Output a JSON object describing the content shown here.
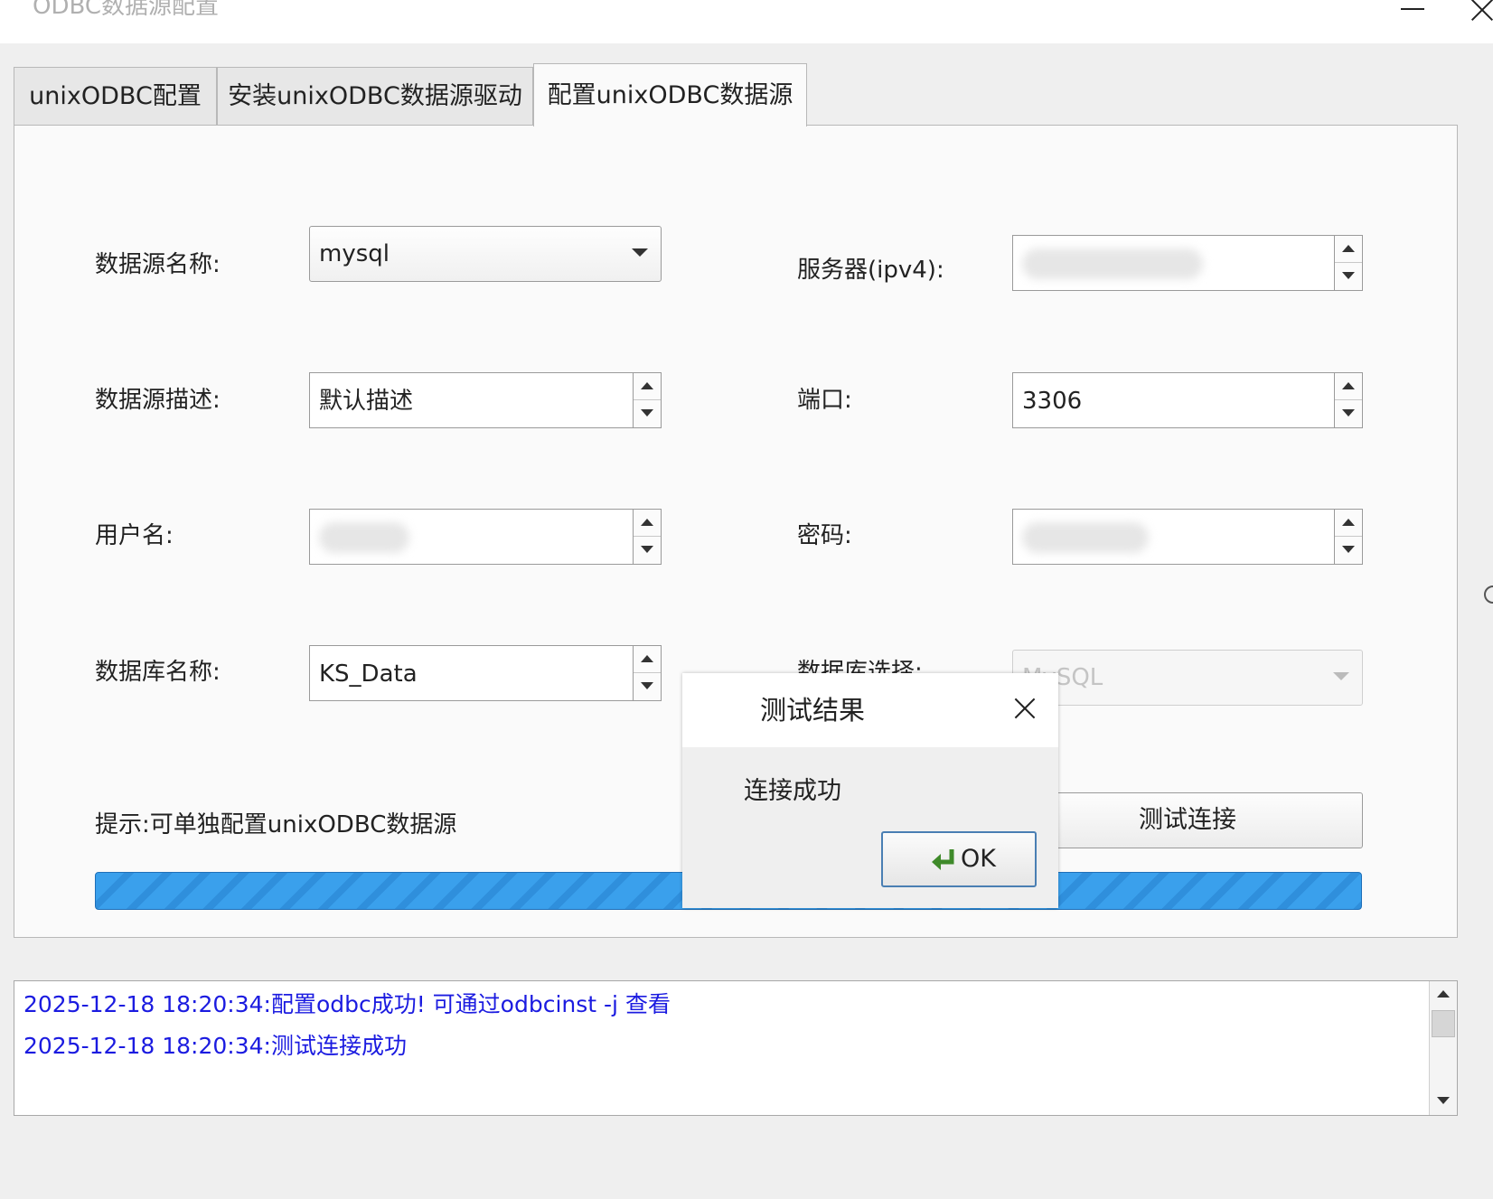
{
  "window": {
    "title": "ODBC数据源配置"
  },
  "tabs": [
    {
      "label": "unixODBC配置",
      "active": false
    },
    {
      "label": "安装unixODBC数据源驱动",
      "active": false
    },
    {
      "label": "配置unixODBC数据源",
      "active": true
    }
  ],
  "form": {
    "datasource_name": {
      "label": "数据源名称:",
      "value": "mysql"
    },
    "datasource_desc": {
      "label": "数据源描述:",
      "value": "默认描述"
    },
    "username": {
      "label": "用户名:",
      "value": ""
    },
    "database_name": {
      "label": "数据库名称:",
      "value": "KS_Data"
    },
    "server": {
      "label": "服务器(ipv4):",
      "value": ""
    },
    "port": {
      "label": "端口:",
      "value": "3306"
    },
    "password": {
      "label": "密码:",
      "value": ""
    },
    "db_select": {
      "label": "数据库选择:",
      "value": "MySQL",
      "disabled": true
    }
  },
  "hint": "提示:可单独配置unixODBC数据源",
  "test_button": "测试连接",
  "progress": {
    "percent": 100
  },
  "dialog": {
    "title": "测试结果",
    "message": "连接成功",
    "ok_label": "OK"
  },
  "log": {
    "lines": [
      "2025-12-18 18:20:34:配置odbc成功! 可通过odbcinst -j 查看",
      "2025-12-18 18:20:34:测试连接成功"
    ]
  },
  "colors": {
    "progress": "#3aa0ec",
    "log_text": "#1b1be0"
  }
}
